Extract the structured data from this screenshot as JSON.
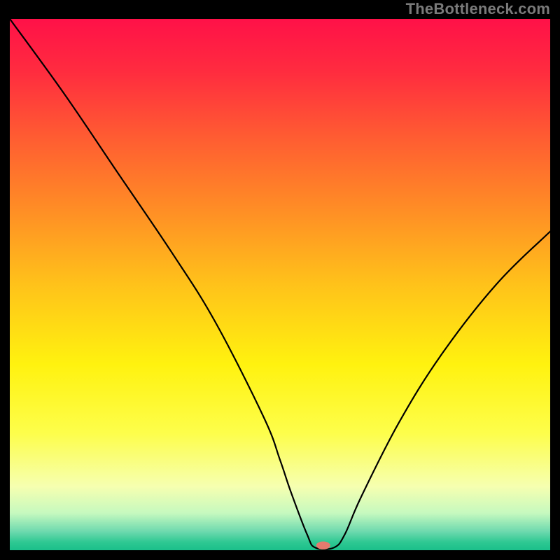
{
  "watermark": "TheBottleneck.com",
  "colors": {
    "gradient_stops": [
      {
        "offset": 0.0,
        "color": "#ff1148"
      },
      {
        "offset": 0.1,
        "color": "#ff2c3f"
      },
      {
        "offset": 0.22,
        "color": "#ff5b32"
      },
      {
        "offset": 0.35,
        "color": "#ff8a26"
      },
      {
        "offset": 0.5,
        "color": "#ffc21a"
      },
      {
        "offset": 0.65,
        "color": "#fff20f"
      },
      {
        "offset": 0.78,
        "color": "#fdfe4b"
      },
      {
        "offset": 0.88,
        "color": "#f6ffb0"
      },
      {
        "offset": 0.93,
        "color": "#c6f9bf"
      },
      {
        "offset": 0.965,
        "color": "#6dd9ae"
      },
      {
        "offset": 0.985,
        "color": "#2ec892"
      },
      {
        "offset": 1.0,
        "color": "#1bbf8a"
      }
    ],
    "curve": "#000000",
    "min_marker": "#e47a6e",
    "background": "#000000"
  },
  "chart_data": {
    "type": "line",
    "title": "",
    "xlabel": "",
    "ylabel": "",
    "xlim": [
      0,
      100
    ],
    "ylim": [
      0,
      100
    ],
    "series": [
      {
        "name": "bottleneck-curve",
        "x": [
          0,
          10,
          20,
          30,
          38,
          47,
          50,
          52,
          55,
          56.5,
          60,
          62,
          65,
          72,
          80,
          90,
          100
        ],
        "values": [
          100,
          86,
          71,
          56,
          43,
          25,
          17,
          11,
          3,
          0.5,
          0.5,
          3,
          10,
          24,
          37,
          50,
          60
        ]
      }
    ],
    "annotations": [
      {
        "name": "min-point",
        "x": 58,
        "y": 0.9
      }
    ]
  }
}
